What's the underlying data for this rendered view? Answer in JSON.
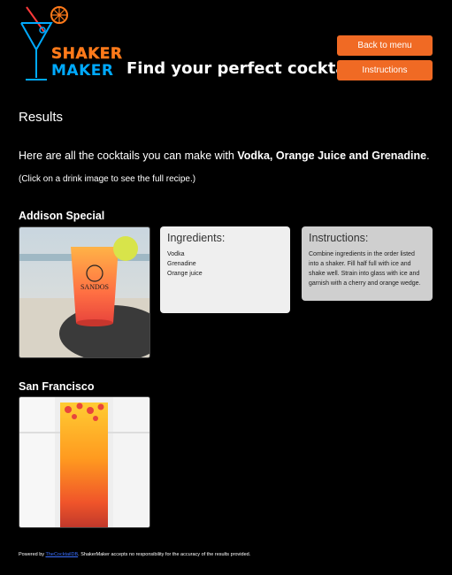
{
  "logo": {
    "line1": "SHAKER",
    "line2": "MAKER"
  },
  "header": {
    "title": "Find your perfect cocktail"
  },
  "buttons": {
    "back": "Back to menu",
    "instructions": "Instructions"
  },
  "results": {
    "heading": "Results",
    "intro_prefix": "Here are all the cocktails you can make with ",
    "intro_ingredients": "Vodka, Orange Juice and Grenadine",
    "intro_suffix": ".",
    "hint": "(Click on a drink image to see the full recipe.)"
  },
  "drinks": [
    {
      "name": "Addison Special",
      "cup_text_1": "SANDOS",
      "ingredients_title": "Ingredients:",
      "ingredients": [
        "Vodka",
        "Grenadine",
        "Orange juice"
      ],
      "instructions_title": "Instructions:",
      "instructions": "Combine ingredients in the order listed into a shaker. Fill half full with ice and shake well. Strain into glass with ice and garnish with a cherry and orange wedge."
    },
    {
      "name": "San Francisco"
    }
  ],
  "footer": {
    "prefix": "Powered by ",
    "link": "TheCocktailDB",
    "suffix": ". ShakerMaker accepts no responsibility for the accuracy of the results provided."
  }
}
